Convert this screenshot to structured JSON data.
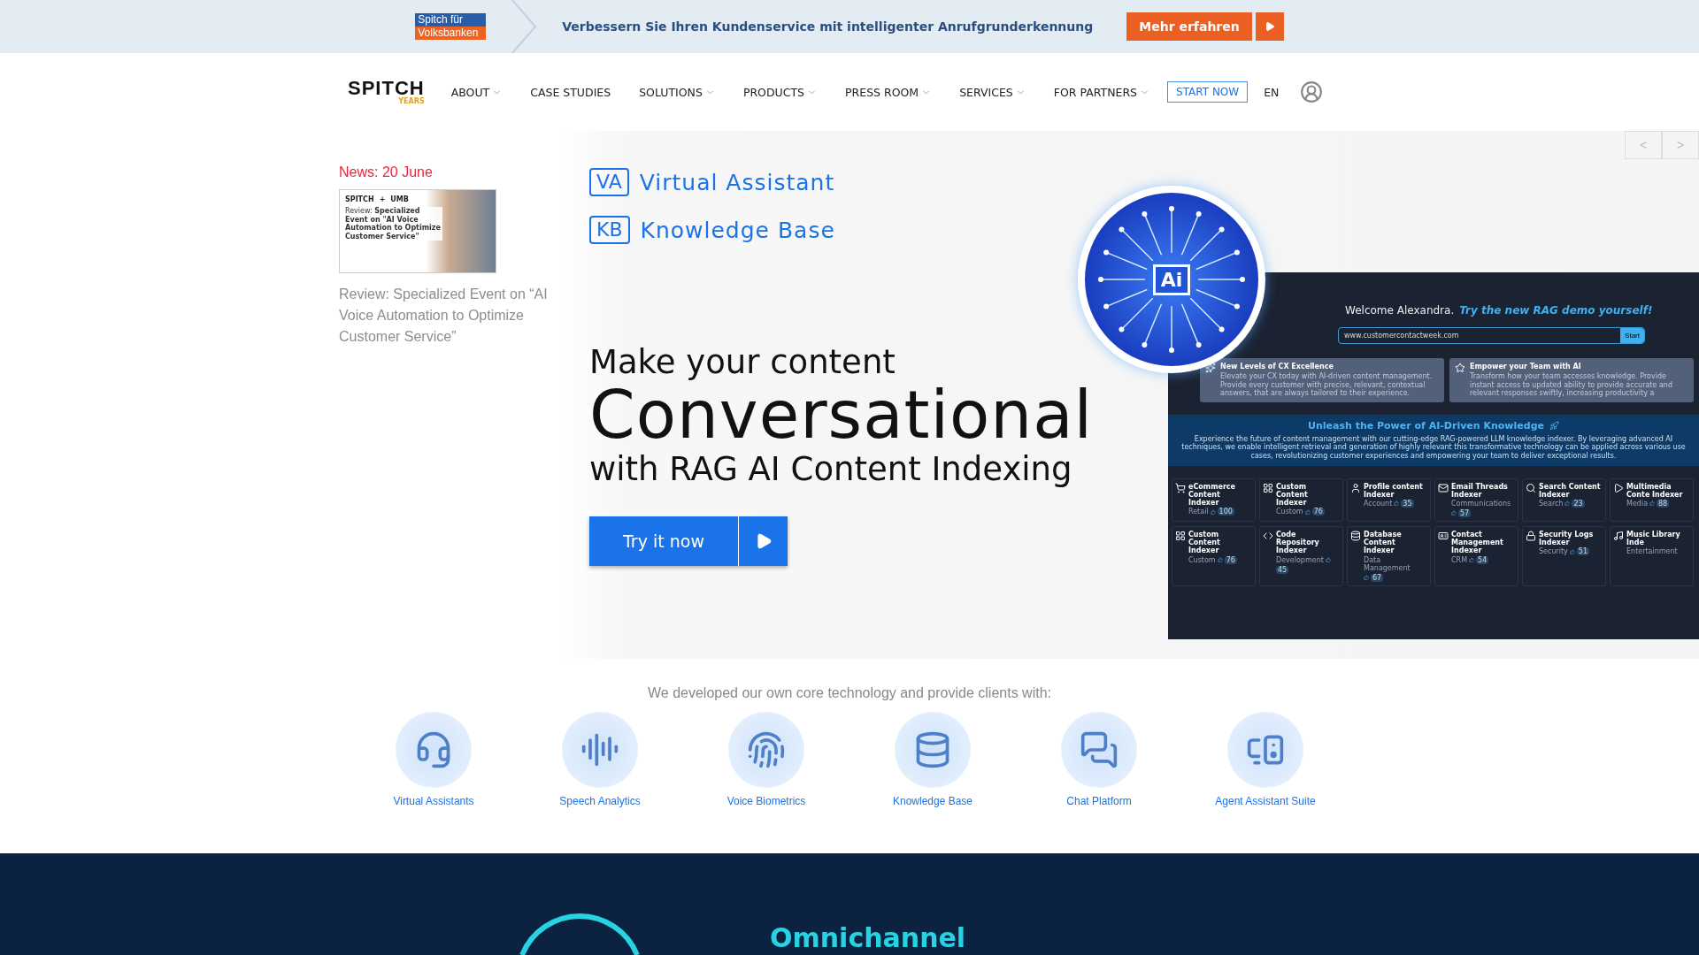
{
  "promo_bar": {
    "badge_top": "Spitch für",
    "badge_bottom": "Volksbanken",
    "message": "Verbessern Sie Ihren Kundenservice mit intelligenter Anrufgrunderkennung",
    "button": "Mehr erfahren"
  },
  "nav": {
    "logo": "SPITCH",
    "logo_sub": "YEARS",
    "items": [
      {
        "label": "ABOUT",
        "dropdown": true
      },
      {
        "label": "CASE STUDIES",
        "dropdown": false
      },
      {
        "label": "SOLUTIONS",
        "dropdown": true
      },
      {
        "label": "PRODUCTS",
        "dropdown": true
      },
      {
        "label": "PRESS ROOM",
        "dropdown": true
      },
      {
        "label": "SERVICES",
        "dropdown": true
      },
      {
        "label": "FOR PARTNERS",
        "dropdown": true
      }
    ],
    "cta": "START NOW",
    "language": "EN"
  },
  "news": {
    "heading": "News: 20 June",
    "thumb_brand_a": "SPITCH",
    "thumb_plus": "+",
    "thumb_brand_b": "UMB",
    "thumb_text": "Review: **Specialized Event on \"AI Voice Automation to Optimize Customer Service\"**",
    "title": "Review: Specialized Event on “AI Voice Automation to Optimize Customer Service”"
  },
  "hero": {
    "tags": [
      {
        "abbr": "VA",
        "label": "Virtual Assistant"
      },
      {
        "abbr": "KB",
        "label": "Knowledge Base"
      }
    ],
    "line1": "Make your content",
    "line2": "Conversational",
    "line3": "with RAG AI Content Indexing",
    "button": "Try it now",
    "carousel": [
      "<",
      ">"
    ]
  },
  "chip": {
    "label": "Ai"
  },
  "demo": {
    "welcome": "Welcome Alexandra.",
    "welcome_cta": "Try the new RAG demo yourself!",
    "url": "www.customercontactweek.com",
    "start": "Start",
    "cards": [
      {
        "title": "New Levels of CX Excellence",
        "text": "Elevate your CX today with AI-driven content management. Provide every customer with precise, relevant, contextual answers, that are always tailored to their experience."
      },
      {
        "title": "Empower your Team with AI",
        "text": "Transform how your team accesses knowledge. Provide instant access to updated ability to provide accurate and relevant responses swiftly, increasing productivity a"
      }
    ],
    "banner_title": "Unleash the Power of AI-Driven Knowledge",
    "banner_text": "Experience the future of content management with our cutting-edge RAG-powered LLM knowledge indexer. By leveraging advanced AI techniques, we enable intelligent retrieval and generation of highly relevant this transformative technology can be applied across various use cases, revolutionizing customer experiences and empowering your team to deliver exceptional results.",
    "tiles": [
      {
        "title": "eCommerce Content Indexer",
        "category": "Retail",
        "count": "100"
      },
      {
        "title": "Custom Content Indexer",
        "category": "Custom",
        "count": "76"
      },
      {
        "title": "Profile content Indexer",
        "category": "Account",
        "count": "35"
      },
      {
        "title": "Email Threads Indexer",
        "category": "Communications",
        "count": "57"
      },
      {
        "title": "Search Content Indexer",
        "category": "Search",
        "count": "23"
      },
      {
        "title": "Multimedia Conte Indexer",
        "category": "Media",
        "count": "88"
      },
      {
        "title": "Custom Content Indexer",
        "category": "Custom",
        "count": "76"
      },
      {
        "title": "Code Repository Indexer",
        "category": "Development",
        "count": "45"
      },
      {
        "title": "Database Content Indexer",
        "category": "Data Management",
        "count": "67"
      },
      {
        "title": "Contact Management Indexer",
        "category": "CRM",
        "count": "54"
      },
      {
        "title": "Security Logs Indexer",
        "category": "Security",
        "count": "51"
      },
      {
        "title": "Music Library Inde",
        "category": "Entertainment"
      }
    ]
  },
  "services": {
    "intro": "We developed our own core technology and provide clients with:",
    "items": [
      "Virtual Assistants",
      "Speech Analytics",
      "Voice Biometrics",
      "Knowledge Base",
      "Chat Platform",
      "Agent Assistant Suite"
    ]
  },
  "footer_teaser": {
    "heading": "Omnichannel"
  }
}
